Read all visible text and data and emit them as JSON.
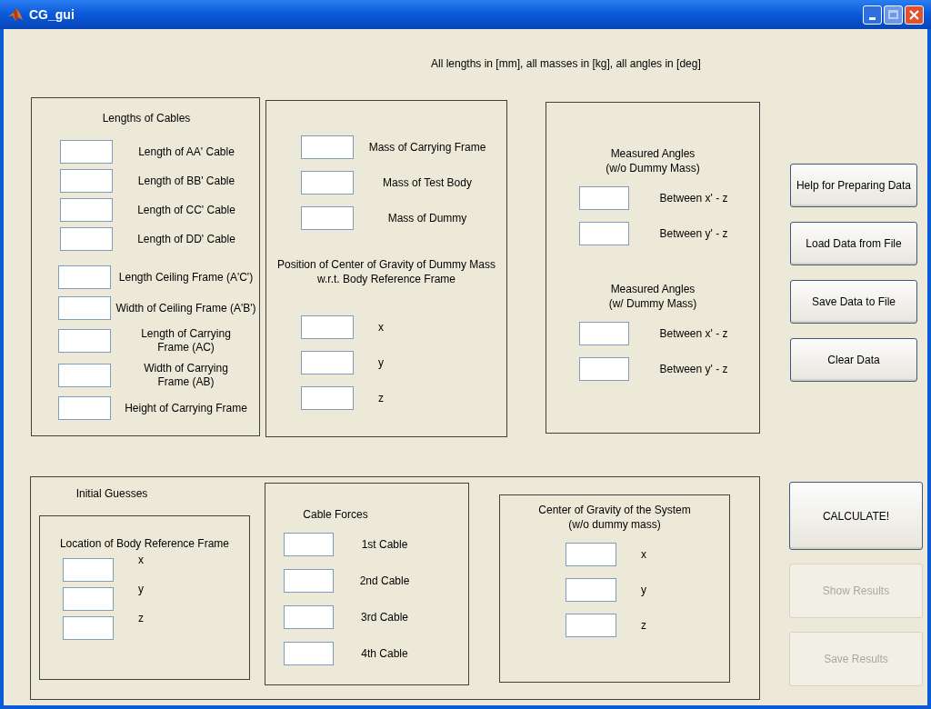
{
  "window": {
    "title": "CG_gui"
  },
  "note": "All lengths in [mm], all masses in [kg], all angles in [deg]",
  "cable_lengths": {
    "title": "Lengths of Cables",
    "cables": [
      {
        "label": "Length of AA' Cable"
      },
      {
        "label": "Length of  BB' Cable"
      },
      {
        "label": "Length of CC' Cable"
      },
      {
        "label": "Length of DD' Cable"
      }
    ],
    "frames": [
      {
        "label": "Length Ceiling Frame (A'C')"
      },
      {
        "label": "Width of Ceiling Frame (A'B')"
      },
      {
        "label": "Length of Carrying\nFrame (AC)"
      },
      {
        "label": "Width of Carrying\nFrame (AB)"
      },
      {
        "label": "Height of Carrying Frame"
      }
    ]
  },
  "masses": {
    "fields": [
      {
        "label": "Mass of Carrying Frame"
      },
      {
        "label": "Mass of Test Body"
      },
      {
        "label": "Mass of Dummy"
      }
    ],
    "cg_title": "Position of Center of Gravity of Dummy Mass\nw.r.t. Body Reference Frame",
    "cg_fields": [
      {
        "label": "x"
      },
      {
        "label": "y"
      },
      {
        "label": "z"
      }
    ]
  },
  "angles": [
    {
      "title": "Measured Angles\n(w/o Dummy Mass)",
      "fields": [
        {
          "label": "Between x' - z"
        },
        {
          "label": "Between y' - z"
        }
      ]
    },
    {
      "title": "Measured Angles\n(w/ Dummy Mass)",
      "fields": [
        {
          "label": "Between x' - z"
        },
        {
          "label": "Between y' - z"
        }
      ]
    }
  ],
  "data_buttons": [
    {
      "label": "Help for Preparing Data",
      "disabled": false
    },
    {
      "label": "Load Data from File",
      "disabled": false
    },
    {
      "label": "Save Data to File",
      "disabled": false
    },
    {
      "label": "Clear Data",
      "disabled": false
    }
  ],
  "initial_guesses": {
    "title": "Initial Guesses",
    "location": {
      "title": "Location of Body Reference Frame",
      "fields": [
        {
          "label": "x"
        },
        {
          "label": "y"
        },
        {
          "label": "z"
        }
      ]
    },
    "cable_forces": {
      "title": "Cable Forces",
      "fields": [
        {
          "label": "1st Cable"
        },
        {
          "label": "2nd Cable"
        },
        {
          "label": "3rd Cable"
        },
        {
          "label": "4th Cable"
        }
      ]
    },
    "system_cg": {
      "title": "Center of Gravity of the System\n(w/o dummy mass)",
      "fields": [
        {
          "label": "x"
        },
        {
          "label": "y"
        },
        {
          "label": "z"
        }
      ]
    }
  },
  "result_buttons": [
    {
      "label": "CALCULATE!",
      "disabled": false
    },
    {
      "label": "Show Results",
      "disabled": true
    },
    {
      "label": "Save Results",
      "disabled": true
    }
  ]
}
